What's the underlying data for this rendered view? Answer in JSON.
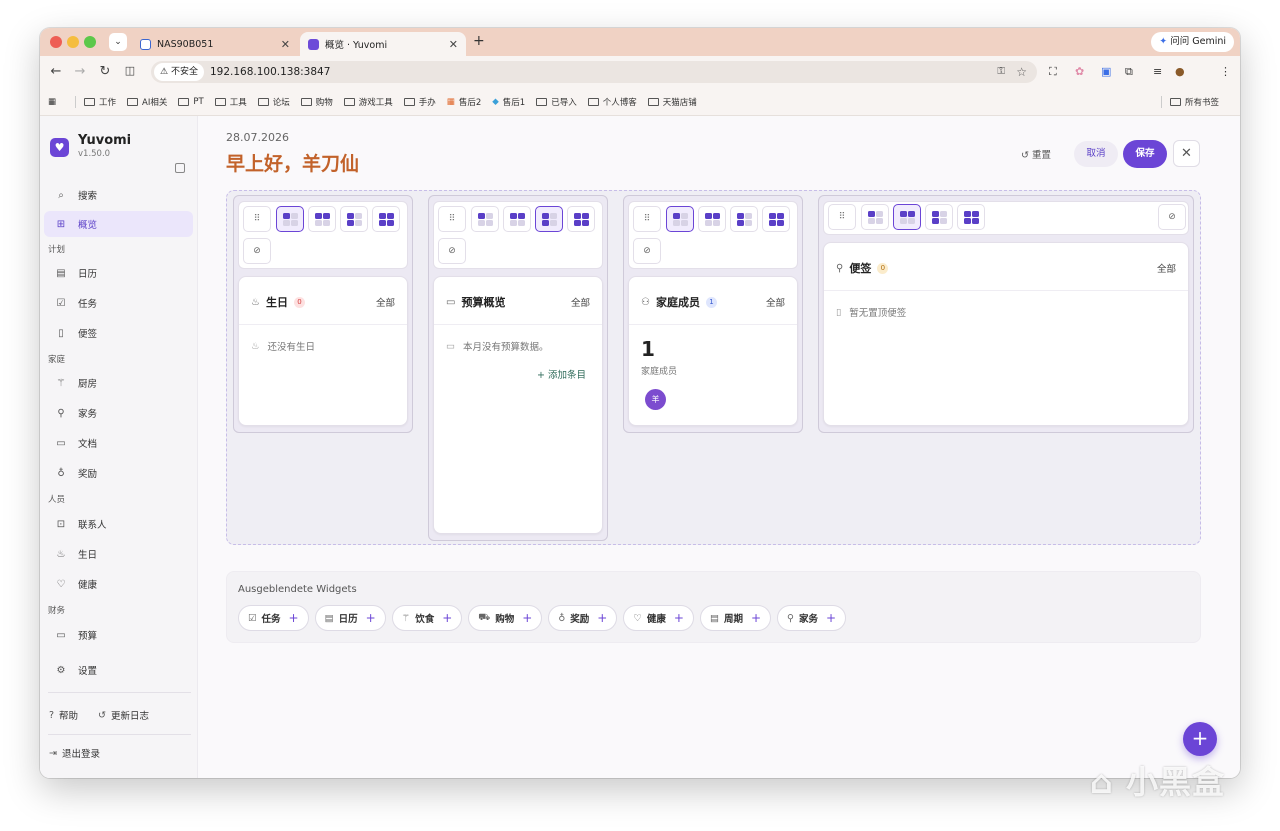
{
  "browser": {
    "tabs": [
      {
        "title": "NAS90B051"
      },
      {
        "title": "概览 · Yuvomi"
      }
    ],
    "gemini_label": "问问 Gemini",
    "security_label": "不安全",
    "url": "192.168.100.138:3847",
    "bookmarks": [
      "工作",
      "AI相关",
      "PT",
      "工具",
      "论坛",
      "购物",
      "游戏工具",
      "手办",
      "售后2",
      "售后1",
      "已导入",
      "个人博客",
      "天猫店铺"
    ],
    "bookmarks_all": "所有书签"
  },
  "sidebar": {
    "app_name": "Yuvomi",
    "version": "v1.50.0",
    "items": [
      {
        "label": "搜索",
        "icon": "search-icon"
      },
      {
        "label": "概览",
        "icon": "grid-icon",
        "active": true
      }
    ],
    "groups": [
      {
        "label": "计划",
        "items": [
          {
            "label": "日历",
            "icon": "calendar-icon"
          },
          {
            "label": "任务",
            "icon": "check-icon"
          },
          {
            "label": "便签",
            "icon": "note-icon"
          }
        ]
      },
      {
        "label": "家庭",
        "items": [
          {
            "label": "厨房",
            "icon": "cutlery-icon"
          },
          {
            "label": "家务",
            "icon": "broom-icon"
          },
          {
            "label": "文档",
            "icon": "folder-icon"
          }
        ]
      },
      {
        "label": "",
        "items": [
          {
            "label": "奖励",
            "icon": "award-icon"
          }
        ]
      },
      {
        "label": "人员",
        "items": [
          {
            "label": "联系人",
            "icon": "contact-icon"
          },
          {
            "label": "生日",
            "icon": "cake-icon"
          },
          {
            "label": "健康",
            "icon": "heart-icon"
          }
        ]
      },
      {
        "label": "财务",
        "items": [
          {
            "label": "预算",
            "icon": "wallet-icon"
          }
        ]
      }
    ],
    "settings": "设置",
    "help": "帮助",
    "changelog": "更新日志",
    "logout": "退出登录"
  },
  "header": {
    "date": "28.07.2026",
    "greeting": "早上好，羊刀仙",
    "reset": "重置",
    "cancel": "取消",
    "save": "保存"
  },
  "widgets": [
    {
      "title": "生日",
      "badge": "0",
      "all": "全部",
      "empty": "还没有生日"
    },
    {
      "title": "预算概览",
      "all": "全部",
      "empty": "本月没有预算数据。",
      "action": "+ 添加条目"
    },
    {
      "title": "家庭成员",
      "badge": "1",
      "all": "全部",
      "count": "1",
      "count_label": "家庭成员",
      "avatar": "羊"
    },
    {
      "title": "便签",
      "badge": "0",
      "all": "全部",
      "empty": "暂无置顶便签"
    }
  ],
  "hidden": {
    "title": "Ausgeblendete Widgets",
    "chips": [
      {
        "label": "任务",
        "icon": "check-icon"
      },
      {
        "label": "日历",
        "icon": "calendar-icon"
      },
      {
        "label": "饮食",
        "icon": "cutlery-icon"
      },
      {
        "label": "购物",
        "icon": "cart-icon"
      },
      {
        "label": "奖励",
        "icon": "award-icon"
      },
      {
        "label": "健康",
        "icon": "heart-icon"
      },
      {
        "label": "周期",
        "icon": "cycle-icon"
      },
      {
        "label": "家务",
        "icon": "broom-icon"
      }
    ]
  },
  "watermark": "小黑盒",
  "colors": {
    "accent": "#6b45d6",
    "greeting": "#c2622a",
    "active_bg": "#ebe6fb"
  }
}
